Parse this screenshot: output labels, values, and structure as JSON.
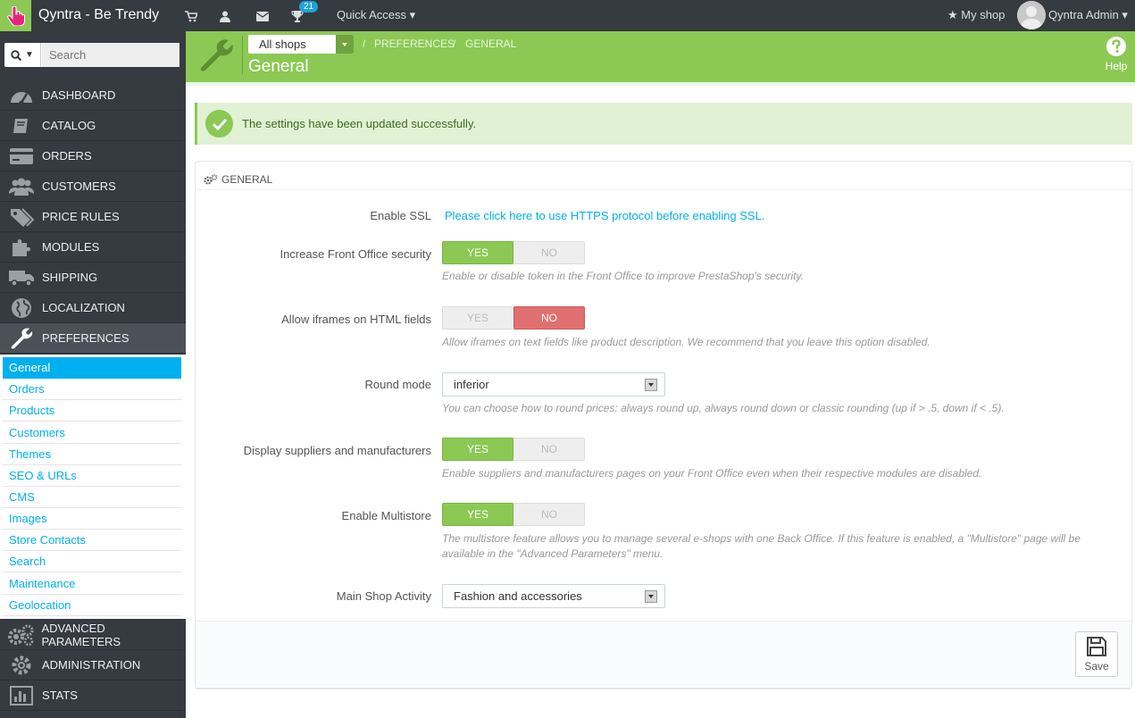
{
  "topbar": {
    "brand": "Qyntra - Be Trendy",
    "notification_count": "21",
    "quick_access": "Quick Access",
    "my_shop": "My shop",
    "admin_name": "Qyntra Admin"
  },
  "search": {
    "placeholder": "Search"
  },
  "sidebar": {
    "items": [
      {
        "label": "Dashboard",
        "icon": "dashboard-icon"
      },
      {
        "label": "Catalog",
        "icon": "book-icon"
      },
      {
        "label": "Orders",
        "icon": "credit-card-icon"
      },
      {
        "label": "Customers",
        "icon": "users-icon"
      },
      {
        "label": "Price Rules",
        "icon": "tags-icon"
      },
      {
        "label": "Modules",
        "icon": "puzzle-icon"
      },
      {
        "label": "Shipping",
        "icon": "truck-icon"
      },
      {
        "label": "Localization",
        "icon": "globe-icon"
      },
      {
        "label": "Preferences",
        "icon": "wrench-icon"
      },
      {
        "label": "Advanced Parameters",
        "icon": "cogs-icon"
      },
      {
        "label": "Administration",
        "icon": "cog-icon"
      },
      {
        "label": "Stats",
        "icon": "bar-chart-icon"
      }
    ],
    "submenu": [
      "General",
      "Orders",
      "Products",
      "Customers",
      "Themes",
      "SEO & URLs",
      "CMS",
      "Images",
      "Store Contacts",
      "Search",
      "Maintenance",
      "Geolocation"
    ]
  },
  "header": {
    "shop_select": "All shops",
    "breadcrumb": [
      "Preferences",
      "General"
    ],
    "title": "General",
    "help": "Help"
  },
  "alert": {
    "text": "The settings have been updated successfully."
  },
  "panel": {
    "heading": "General",
    "ssl_label": "Enable SSL",
    "ssl_link": "Please click here to use HTTPS protocol before enabling SSL.",
    "front_security_label": "Increase Front Office security",
    "front_security_help": "Enable or disable token in the Front Office to improve PrestaShop's security.",
    "iframes_label": "Allow iframes on HTML fields",
    "iframes_help": "Allow iframes on text fields like product description. We recommend that you leave this option disabled.",
    "round_label": "Round mode",
    "round_value": "inferior",
    "round_help": "You can choose how to round prices: always round up, always round down or classic rounding (up if > .5, down if < .5).",
    "suppliers_label": "Display suppliers and manufacturers",
    "suppliers_help": "Enable suppliers and manufacturers pages on your Front Office even when their respective modules are disabled.",
    "multistore_label": "Enable Multistore",
    "multistore_help": "The multistore feature allows you to manage several e-shops with one Back Office. If this feature is enabled, a \"Multistore\" page will be available in the \"Advanced Parameters\" menu.",
    "activity_label": "Main Shop Activity",
    "activity_value": "Fashion and accessories",
    "yes": "YES",
    "no": "NO",
    "save": "Save"
  },
  "colors": {
    "brand_green": "#8bc954",
    "link_blue": "#00aff0",
    "dark": "#363a41",
    "no_red": "#e07070"
  }
}
